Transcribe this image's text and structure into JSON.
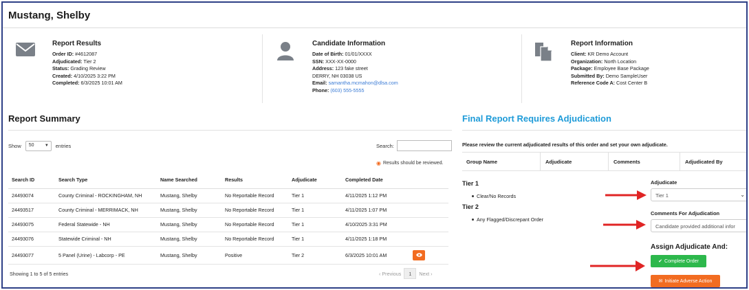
{
  "header": {
    "name": "Mustang, Shelby"
  },
  "report_results": {
    "title": "Report Results",
    "rows": [
      {
        "label": "Order ID:",
        "value": " #4612087"
      },
      {
        "label": "Adjudicated:",
        "value": " Tier 2"
      },
      {
        "label": "Status:",
        "value": " Grading Review"
      },
      {
        "label": "Created:",
        "value": " 4/10/2025 3:22 PM"
      },
      {
        "label": "Completed:",
        "value": " 6/3/2025 10:01 AM"
      }
    ]
  },
  "candidate_info": {
    "title": "Candidate Information",
    "dob_label": "Date of Birth:",
    "dob": " 01/01/XXXX",
    "ssn_label": "SSN:",
    "ssn": " XXX-XX-0000",
    "address_label": "Address:",
    "address": " 123 fake street",
    "city": "DERRY, NH 03038 US",
    "email_label": "Email:",
    "email": " samantha.mcmahon@dlsa.com",
    "phone_label": "Phone:",
    "phone": " (603) 555-5555"
  },
  "report_info": {
    "title": "Report Information",
    "rows": [
      {
        "label": "Client:",
        "value": " KR Demo Account"
      },
      {
        "label": "Organization:",
        "value": " North Location"
      },
      {
        "label": "Package:",
        "value": " Employee Base Package"
      },
      {
        "label": "Submitted By:",
        "value": " Demo SampleUser"
      },
      {
        "label": "Reference Code A:",
        "value": " Cost Center B"
      }
    ]
  },
  "summary": {
    "title": "Report Summary",
    "show_label": "Show",
    "entries_value": "50",
    "entries_label": "entries",
    "search_label": "Search:",
    "review_note": "Results should be reviewed.",
    "columns": [
      "Search ID",
      "Search Type",
      "Name Searched",
      "Results",
      "Adjudicate",
      "Completed Date"
    ],
    "rows": [
      [
        "24493074",
        "County Criminal - ROCKINGHAM, NH",
        "Mustang, Shelby",
        "No Reportable Record",
        "Tier 1",
        "4/11/2025 1:12 PM"
      ],
      [
        "24493517",
        "County Criminal - MERRIMACK, NH",
        "Mustang, Shelby",
        "No Reportable Record",
        "Tier 1",
        "4/11/2025 1:07 PM"
      ],
      [
        "24493075",
        "Federal Statewide - NH",
        "Mustang, Shelby",
        "No Reportable Record",
        "Tier 1",
        "4/10/2025 3:31 PM"
      ],
      [
        "24493076",
        "Statewide Criminal - NH",
        "Mustang, Shelby",
        "No Reportable Record",
        "Tier 1",
        "4/11/2025 1:18 PM"
      ],
      [
        "24493077",
        "5 Panel (Urine) - Labcorp - PE",
        "Mustang, Shelby",
        "Positive",
        "Tier 2",
        "6/3/2025 10:01 AM"
      ]
    ],
    "showing": "Showing 1 to 5 of 5 entries",
    "prev": "Previous",
    "page": "1",
    "next": "Next"
  },
  "adjudication": {
    "title": "Final Report Requires Adjudication",
    "note": "Please review the current adjudicated results of this order and set your own adjudicate.",
    "columns": [
      "Group Name",
      "Adjudicate",
      "Comments",
      "Adjudicated By"
    ],
    "tier1": "Tier 1",
    "tier1_item": "Clear/No Records",
    "tier2": "Tier 2",
    "tier2_item": "Any Flagged/Discrepant Order",
    "adjudicate_label": "Adjudicate",
    "adjudicate_value": "Tier 1",
    "comments_label": "Comments For Adjudication",
    "comments_value": "Candidate provided additional infor",
    "assign_title": "Assign Adjudicate And:",
    "complete_btn": "Complete Order",
    "adverse_btn": "Initiate Adverse Action"
  },
  "colors": {
    "accent_blue": "#1e9bd8",
    "green": "#2db84c",
    "orange": "#f26c21",
    "arrow_red": "#e02424",
    "frame": "#2d3f86"
  }
}
